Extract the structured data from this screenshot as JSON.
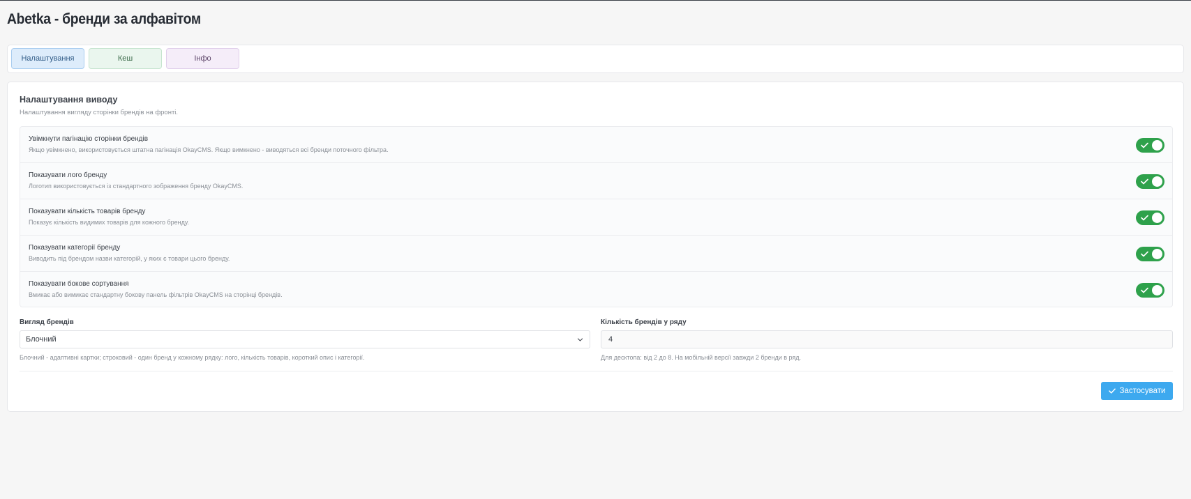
{
  "page": {
    "title": "Abetka - бренди за алфавітом"
  },
  "tabs": [
    {
      "label": "Налаштування",
      "active": true
    },
    {
      "label": "Кеш",
      "active": false
    },
    {
      "label": "Інфо",
      "active": false
    }
  ],
  "output_settings": {
    "title": "Налаштування виводу",
    "description": "Налаштування вигляду сторінки брендів на фронті.",
    "options": [
      {
        "title": "Увімкнути пагінацію сторінки брендів",
        "description": "Якщо увімкнено, використовується штатна пагінація OkayCMS. Якщо вимкнено - виводяться всі бренди поточного фільтра.",
        "enabled": true
      },
      {
        "title": "Показувати лого бренду",
        "description": "Логотип використовується із стандартного зображення бренду OkayCMS.",
        "enabled": true
      },
      {
        "title": "Показувати кількість товарів бренду",
        "description": "Показує кількість видимих товарів для кожного бренду.",
        "enabled": true
      },
      {
        "title": "Показувати категорії бренду",
        "description": "Виводить під брендом назви категорій, у яких є товари цього бренду.",
        "enabled": true
      },
      {
        "title": "Показувати бокове сортування",
        "description": "Вмикає або вимикає стандартну бокову панель фільтрів OkayCMS на сторінці брендів.",
        "enabled": true
      }
    ]
  },
  "brand_view": {
    "label": "Вигляд брендів",
    "selected": "Блочний",
    "help": "Блочний - адаптивні картки; строковий - один бренд у кожному рядку: лого, кількість товарів, короткий опис і категорії."
  },
  "brands_per_row": {
    "label": "Кількість брендів у ряду",
    "value": "4",
    "help": "Для десктопа: від 2 до 8. На мобільній версії завжди 2 бренди в ряд."
  },
  "actions": {
    "apply_label": "Застосувати"
  },
  "colors": {
    "toggle_on": "#2ea14b",
    "apply_button": "#3da9ef",
    "tab_settings_bg": "#ddecfb",
    "tab_cache_bg": "#eaf6ee",
    "tab_info_bg": "#f5edf9"
  }
}
